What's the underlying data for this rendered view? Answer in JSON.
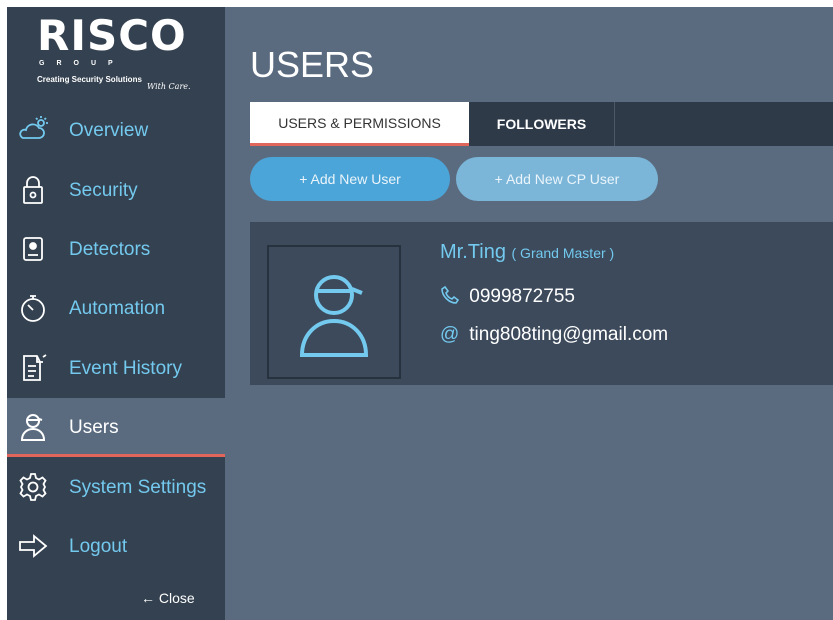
{
  "logo": {
    "brand": "RISCO",
    "group": "GROUP",
    "tagline": "Creating Security Solutions",
    "tagline_suffix": "With Care."
  },
  "sidebar": {
    "items": [
      {
        "label": "Overview",
        "icon": "weather-icon"
      },
      {
        "label": "Security",
        "icon": "lock-icon"
      },
      {
        "label": "Detectors",
        "icon": "detector-icon"
      },
      {
        "label": "Automation",
        "icon": "timer-icon"
      },
      {
        "label": "Event History",
        "icon": "event-history-icon"
      },
      {
        "label": "Users",
        "icon": "user-icon",
        "active": true
      },
      {
        "label": "System Settings",
        "icon": "gear-icon"
      },
      {
        "label": "Logout",
        "icon": "logout-arrow-icon"
      }
    ],
    "close_label": "← Close"
  },
  "main": {
    "title": "USERS",
    "tabs": [
      {
        "label": "USERS & PERMISSIONS",
        "active": true
      },
      {
        "label": "FOLLOWERS",
        "active": false
      }
    ],
    "buttons": {
      "add_user": "+ Add New User",
      "add_cp_user": "+ Add New CP User"
    },
    "user_card": {
      "name": "Mr.Ting",
      "role": "( Grand Master )",
      "phone": "0999872755",
      "email_prefix": "@",
      "email": "ting808ting@gmail.com"
    }
  },
  "colors": {
    "sidebar_bg": "#344150",
    "main_bg": "#5a6b80",
    "accent_blue": "#73c9ee",
    "accent_red": "#e0655a",
    "button_primary": "#4ba5d8",
    "button_secondary": "#7bb6d9",
    "card_bg": "#3c4a5c"
  }
}
